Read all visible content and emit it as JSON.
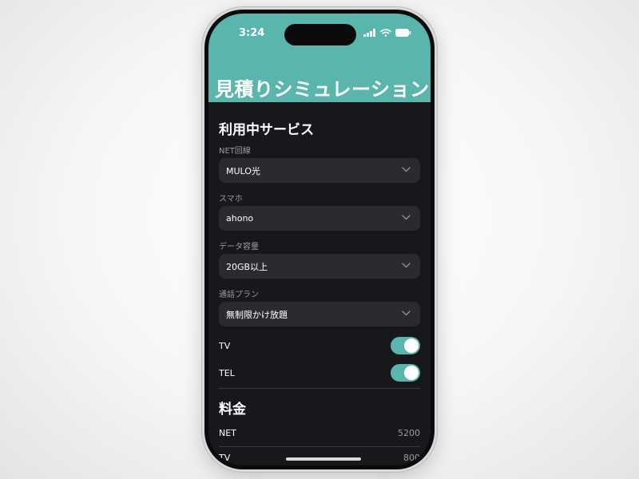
{
  "status": {
    "time": "3:24"
  },
  "header": {
    "title": "見積りシミュレーション"
  },
  "services": {
    "title": "利用中サービス",
    "net": {
      "label": "NET回線",
      "value": "MULO光"
    },
    "phone": {
      "label": "スマホ",
      "value": "ahono"
    },
    "data": {
      "label": "データ容量",
      "value": "20GB以上"
    },
    "call": {
      "label": "通話プラン",
      "value": "無制限かけ放題"
    },
    "tv": {
      "label": "TV",
      "on": true
    },
    "tel": {
      "label": "TEL",
      "on": true
    }
  },
  "pricing": {
    "title": "料金",
    "rows": [
      {
        "name": "NET",
        "value": "5200"
      },
      {
        "name": "TV",
        "value": "800"
      }
    ]
  },
  "colors": {
    "accent": "#5ab5ac",
    "background": "#17181b",
    "field": "#2a2b2f"
  },
  "icons": {
    "status": [
      "signal-icon",
      "wifi-icon",
      "battery-icon"
    ],
    "dropdown": "chevron-down-icon"
  }
}
